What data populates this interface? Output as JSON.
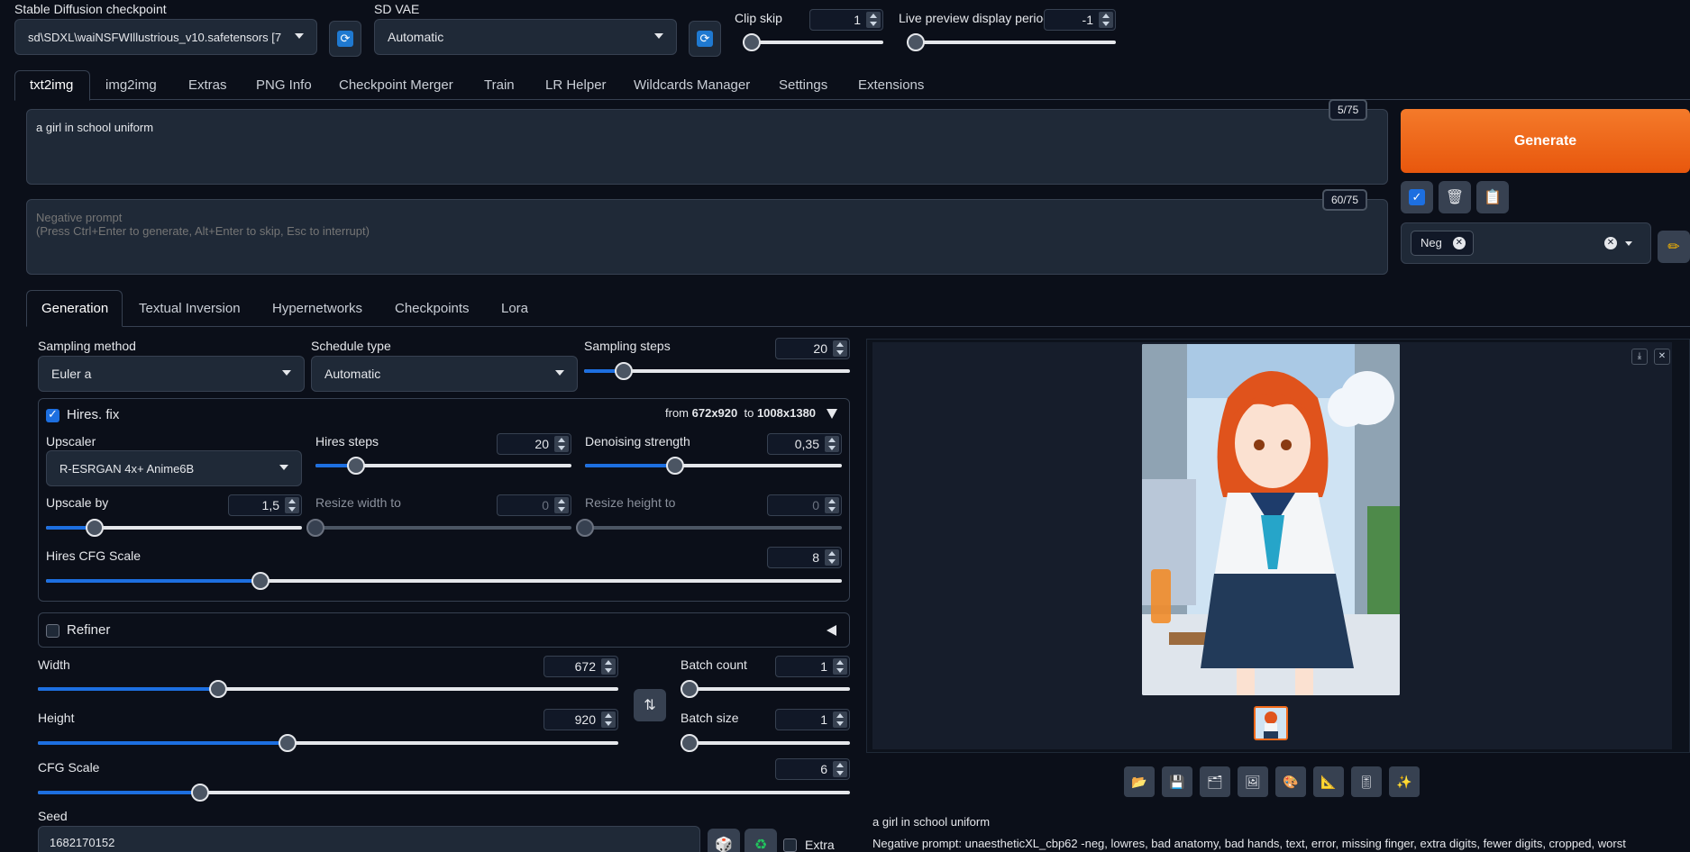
{
  "top": {
    "checkpoint_label": "Stable Diffusion checkpoint",
    "checkpoint_value": "sd\\SDXL\\waiNSFWIllustrious_v10.safetensors [7",
    "vae_label": "SD VAE",
    "vae_value": "Automatic",
    "clip_skip_label": "Clip skip",
    "clip_skip_value": "1",
    "clip_skip_level": 0,
    "preview_label": "Live preview display period",
    "preview_value": "-1",
    "preview_level": 0
  },
  "main_tabs": [
    "txt2img",
    "img2img",
    "Extras",
    "PNG Info",
    "Checkpoint Merger",
    "Train",
    "LR Helper",
    "Wildcards Manager",
    "Settings",
    "Extensions"
  ],
  "prompt": {
    "text": "a girl in school uniform",
    "counter": "5/75",
    "neg_placeholder": "Negative prompt\n(Press Ctrl+Enter to generate, Alt+Enter to skip, Esc to interrupt)",
    "neg_counter": "60/75"
  },
  "actions": {
    "generate": "Generate",
    "style_chip": "Neg"
  },
  "sub_tabs": [
    "Generation",
    "Textual Inversion",
    "Hypernetworks",
    "Checkpoints",
    "Lora"
  ],
  "gen": {
    "sampling_method_label": "Sampling method",
    "sampling_method_value": "Euler a",
    "schedule_type_label": "Schedule type",
    "schedule_type_value": "Automatic",
    "sampling_steps_label": "Sampling steps",
    "sampling_steps_value": "20",
    "sampling_steps_fraction": 0.15
  },
  "hires": {
    "title": "Hires. fix",
    "from_prefix": "from",
    "from_size": "672x920",
    "to_prefix": "to",
    "to_size": "1008x1380",
    "upscaler_label": "Upscaler",
    "upscaler_value": "R-ESRGAN 4x+ Anime6B",
    "hires_steps_label": "Hires steps",
    "hires_steps_value": "20",
    "hires_steps_fraction": 0.16,
    "denoise_label": "Denoising strength",
    "denoise_value": "0,35",
    "denoise_fraction": 0.35,
    "upscale_by_label": "Upscale by",
    "upscale_by_value": "1,5",
    "upscale_by_fraction": 0.19,
    "resize_w_label": "Resize width to",
    "resize_w_value": "0",
    "resize_h_label": "Resize height to",
    "resize_h_value": "0",
    "cfg_label": "Hires CFG Scale",
    "cfg_value": "8",
    "cfg_fraction": 0.27
  },
  "refiner": {
    "title": "Refiner"
  },
  "dims": {
    "width_label": "Width",
    "width_value": "672",
    "width_fraction": 0.31,
    "height_label": "Height",
    "height_value": "920",
    "height_fraction": 0.43,
    "batch_count_label": "Batch count",
    "batch_count_value": "1",
    "batch_size_label": "Batch size",
    "batch_size_value": "1",
    "cfg_label": "CFG Scale",
    "cfg_value": "6",
    "cfg_fraction": 0.2,
    "seed_label": "Seed",
    "seed_value": "1682170152",
    "extra_label": "Extra"
  },
  "output": {
    "caption": "a girl in school uniform",
    "neg_caption": "Negative prompt: unaestheticXL_cbp62 -neg, lowres, bad anatomy, bad hands, text, error, missing finger, extra digits, fewer digits, cropped, worst"
  },
  "colors": {
    "accent": "#1d6fe0",
    "generate": "#f26a1b",
    "bg": "#0b0f19"
  }
}
